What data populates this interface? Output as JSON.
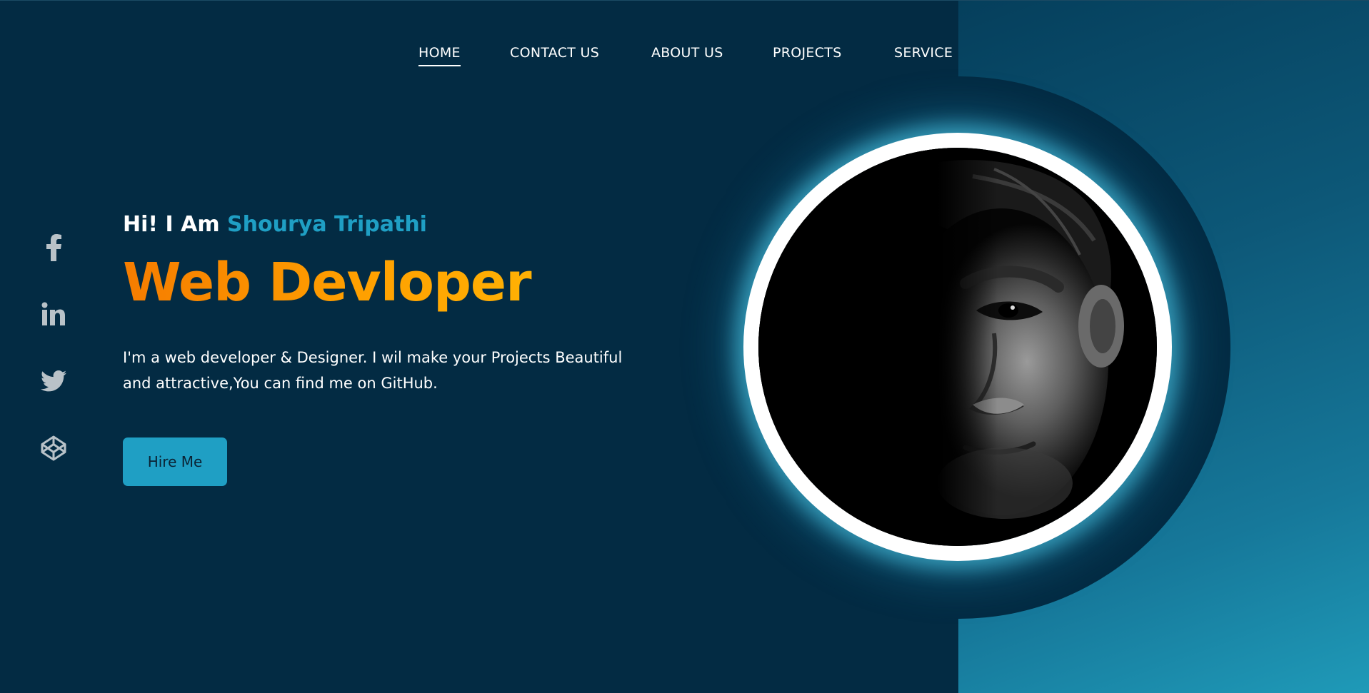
{
  "nav": {
    "items": [
      {
        "label": "HOME",
        "active": true
      },
      {
        "label": "CONTACT US",
        "active": false
      },
      {
        "label": "ABOUT US",
        "active": false
      },
      {
        "label": "PROJECTS",
        "active": false
      },
      {
        "label": "SERVICE",
        "active": false
      }
    ]
  },
  "social": {
    "icons": [
      "facebook-icon",
      "linkedin-icon",
      "twitter-icon",
      "codepen-icon"
    ]
  },
  "hero": {
    "greeting_prefix": "Hi! I Am ",
    "name": "Shourya Tripathi",
    "role": "Web Devloper",
    "description_line1": "I'm a web developer & Designer. I wil make your Projects Beautiful",
    "description_line2": "and attractive,You can find me on GitHub.",
    "cta_label": "Hire Me"
  },
  "colors": {
    "background": "#032b43",
    "accent": "#1f9fc4",
    "role_gradient_start": "#f57c00",
    "role_gradient_end": "#ffc107",
    "text": "#ffffff"
  }
}
